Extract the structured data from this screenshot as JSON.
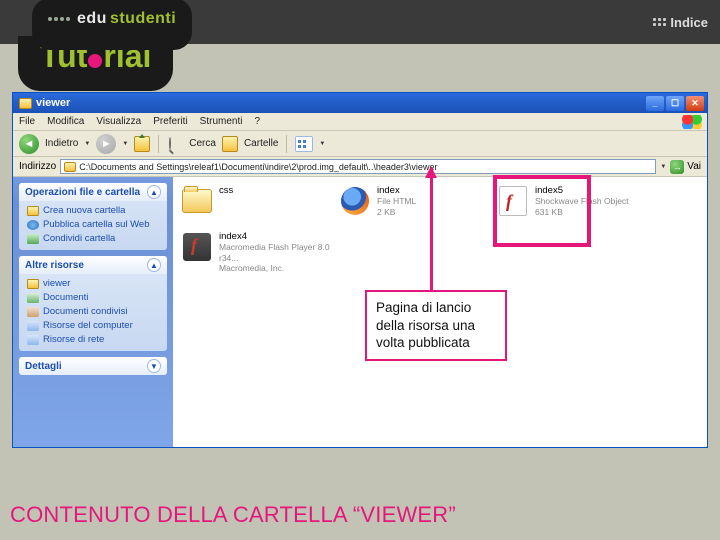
{
  "header": {
    "brand_white": "edu",
    "brand_green": "studenti",
    "indice": "Indice",
    "tutorial_a": "Tut",
    "tutorial_b": "rial"
  },
  "window": {
    "title": "viewer",
    "menu": [
      "File",
      "Modifica",
      "Visualizza",
      "Preferiti",
      "Strumenti",
      "?"
    ],
    "toolbar": {
      "back": "Indietro",
      "search": "Cerca",
      "folders": "Cartelle"
    },
    "address": {
      "label": "Indirizzo",
      "path": "C:\\Documents and Settings\\releaf1\\Documenti\\indire\\2\\prod.img_default\\..\\header3\\viewer",
      "go": "Vai"
    }
  },
  "tasks": {
    "group1": {
      "title": "Operazioni file e cartella",
      "items": [
        "Crea nuova cartella",
        "Pubblica cartella sul Web",
        "Condividi cartella"
      ]
    },
    "group2": {
      "title": "Altre risorse",
      "items": [
        "viewer",
        "Documenti",
        "Documenti condivisi",
        "Risorse del computer",
        "Risorse di rete"
      ]
    },
    "group3": {
      "title": "Dettagli"
    }
  },
  "files": [
    {
      "name": "css",
      "type": "",
      "size": ""
    },
    {
      "name": "index",
      "type": "File HTML",
      "size": "2 KB"
    },
    {
      "name": "index5",
      "type": "Shockwave Flash Object",
      "size": "631 KB"
    },
    {
      "name": "index4",
      "type": "Macromedia Flash Player 8.0 r34...",
      "size": "Macromedia, Inc."
    }
  ],
  "callout": "Pagina di lancio della risorsa una volta pubblicata",
  "caption": "CONTENUTO DELLA CARTELLA “VIEWER”"
}
